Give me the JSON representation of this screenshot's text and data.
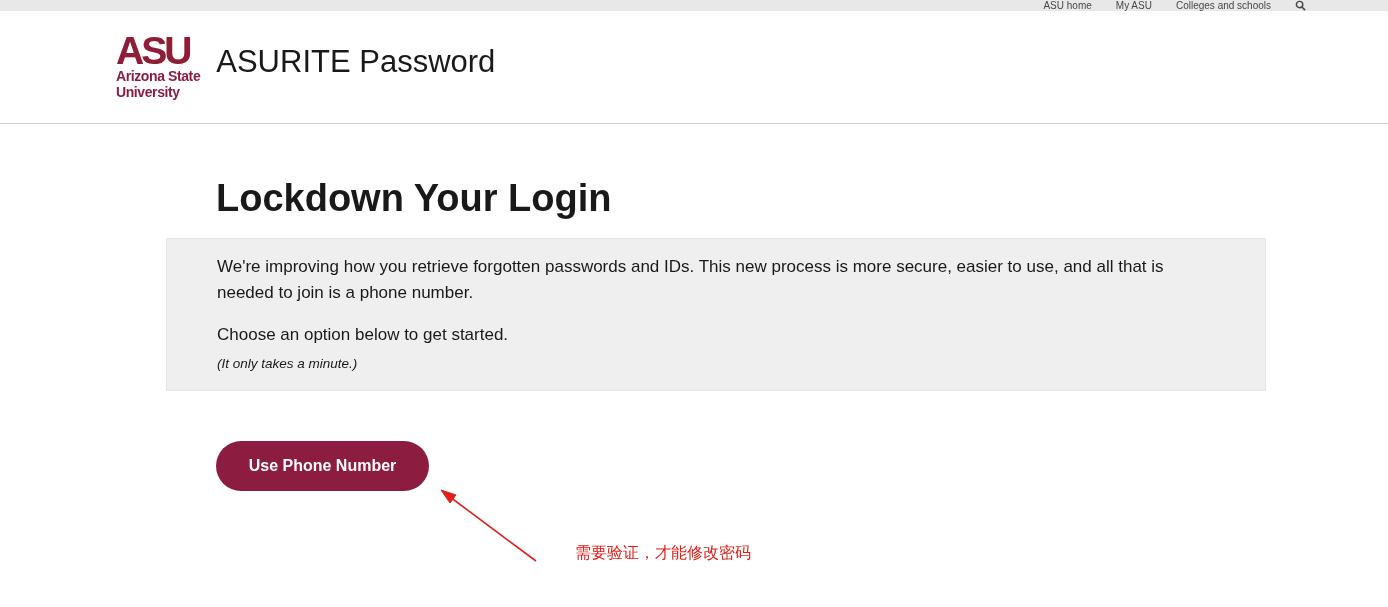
{
  "top_nav": {
    "links": [
      "ASU home",
      "My ASU",
      "Colleges and schools"
    ]
  },
  "header": {
    "logo": {
      "mark": "ASU",
      "name_lines": [
        "Arizona State",
        "University"
      ]
    },
    "title": "ASURITE Password"
  },
  "main": {
    "heading": "Lockdown Your Login",
    "notice": {
      "paragraphs": [
        "We're improving how you retrieve forgotten passwords and IDs. This new process is more secure, easier to use, and all that is needed to join is a phone number.",
        "Choose an option below to get started."
      ],
      "note": "(It only takes a minute.)"
    },
    "button": "Use Phone Number"
  },
  "annotation": {
    "text": "需要验证，才能修改密码"
  }
}
